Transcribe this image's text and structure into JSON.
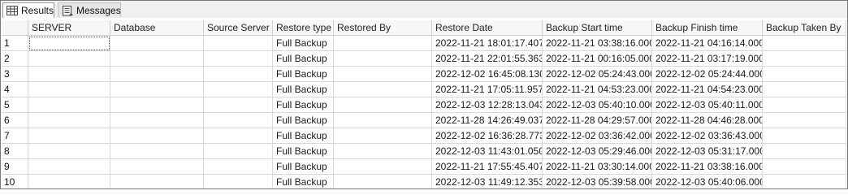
{
  "tabs": [
    {
      "label": "Results",
      "icon": "grid-icon",
      "active": true
    },
    {
      "label": "Messages",
      "icon": "messages-icon",
      "active": false
    }
  ],
  "columns": [
    "SERVER",
    "Database",
    "Source Server",
    "Restore type",
    "Restored By",
    "Restore Date",
    "Backup Start time",
    "Backup Finish time",
    "Backup Taken By"
  ],
  "rows": [
    {
      "num": "1",
      "cells": [
        "",
        "",
        "",
        "Full Backup",
        "",
        "2022-11-21 18:01:17.407",
        "2022-11-21 03:38:16.000",
        "2022-11-21 04:16:14.000",
        ""
      ]
    },
    {
      "num": "2",
      "cells": [
        "",
        "",
        "",
        "Full Backup",
        "",
        "2022-11-21 22:01:55.363",
        "2022-11-21 00:16:05.000",
        "2022-11-21 03:17:19.000",
        ""
      ]
    },
    {
      "num": "3",
      "cells": [
        "",
        "",
        "",
        "Full Backup",
        "",
        "2022-12-02 16:45:08.130",
        "2022-12-02 05:24:43.000",
        "2022-12-02 05:24:44.000",
        ""
      ]
    },
    {
      "num": "4",
      "cells": [
        "",
        "",
        "",
        "Full Backup",
        "",
        "2022-11-21 17:05:11.957",
        "2022-11-21 04:53:23.000",
        "2022-11-21 04:54:23.000",
        ""
      ]
    },
    {
      "num": "5",
      "cells": [
        "",
        "",
        "",
        "Full Backup",
        "",
        "2022-12-03 12:28:13.043",
        "2022-12-03 05:40:10.000",
        "2022-12-03 05:40:11.000",
        ""
      ]
    },
    {
      "num": "6",
      "cells": [
        "",
        "",
        "",
        "Full Backup",
        "",
        "2022-11-28 14:26:49.037",
        "2022-11-28 04:29:57.000",
        "2022-11-28 04:46:28.000",
        ""
      ]
    },
    {
      "num": "7",
      "cells": [
        "",
        "",
        "",
        "Full Backup",
        "",
        "2022-12-02 16:36:28.773",
        "2022-12-02 03:36:42.000",
        "2022-12-02 03:36:43.000",
        ""
      ]
    },
    {
      "num": "8",
      "cells": [
        "",
        "",
        "",
        "Full Backup",
        "",
        "2022-12-03 11:43:01.050",
        "2022-12-03 05:29:46.000",
        "2022-12-03 05:31:17.000",
        ""
      ]
    },
    {
      "num": "9",
      "cells": [
        "",
        "",
        "",
        "Full Backup",
        "",
        "2022-11-21 17:55:45.407",
        "2022-11-21 03:30:14.000",
        "2022-11-21 03:38:16.000",
        ""
      ]
    },
    {
      "num": "10",
      "cells": [
        "",
        "",
        "",
        "Full Backup",
        "",
        "2022-12-03 11:49:12.353",
        "2022-12-03 05:39:58.000",
        "2022-12-03 05:40:06.000",
        ""
      ]
    }
  ]
}
